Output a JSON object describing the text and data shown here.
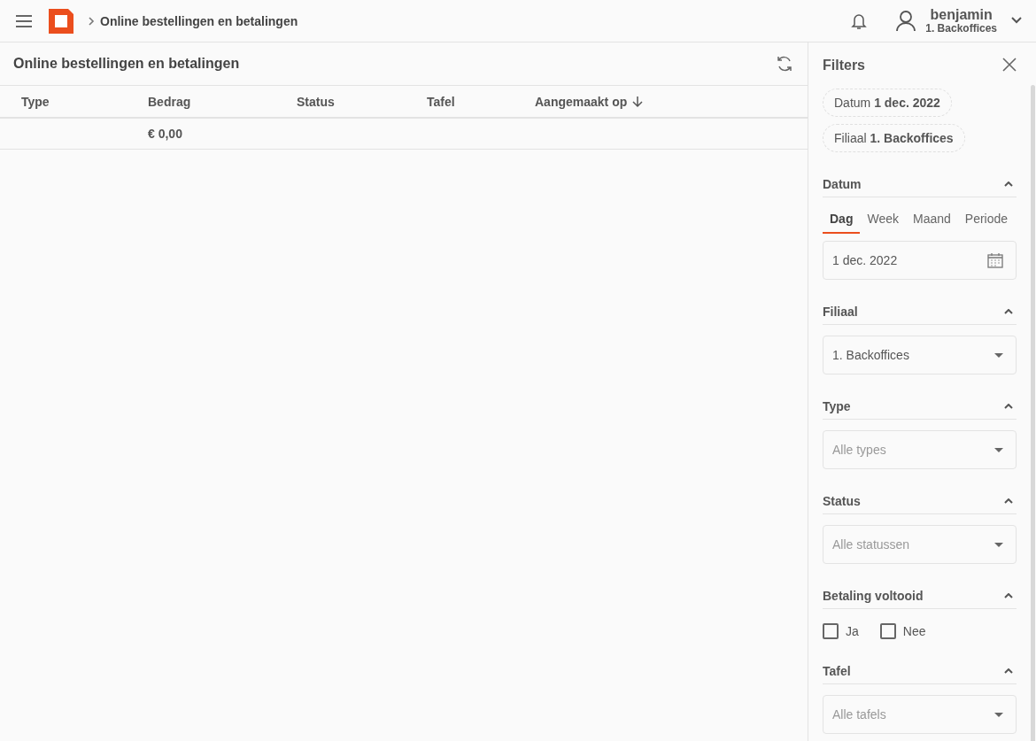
{
  "header": {
    "breadcrumb": "Online bestellingen en betalingen",
    "user": {
      "name": "benjamin",
      "branch": "1. Backoffices"
    }
  },
  "main": {
    "title": "Online bestellingen en betalingen",
    "columns": [
      {
        "label": "Type",
        "sorted": false
      },
      {
        "label": "Bedrag",
        "sorted": false
      },
      {
        "label": "Status",
        "sorted": false
      },
      {
        "label": "Tafel",
        "sorted": false
      },
      {
        "label": "Aangemaakt op",
        "sorted": true
      }
    ],
    "rows": [
      [
        "",
        "€ 0,00",
        "",
        "",
        ""
      ]
    ]
  },
  "filters": {
    "title": "Filters",
    "chips": [
      "Datum **1 dec. 2022**",
      "Filiaal **1. Backoffices**"
    ],
    "sections": [
      {
        "kind": "date",
        "title": "Datum",
        "expanded": true,
        "tabs": [
          {
            "label": "Dag",
            "selected": true
          },
          {
            "label": "Week",
            "selected": false
          },
          {
            "label": "Maand",
            "selected": false
          },
          {
            "label": "Periode",
            "selected": false
          }
        ],
        "value": "1 dec. 2022"
      },
      {
        "kind": "select",
        "title": "Filiaal",
        "expanded": true,
        "value": "1. Backoffices"
      },
      {
        "kind": "select",
        "title": "Type",
        "expanded": true,
        "placeholder": "Alle types"
      },
      {
        "kind": "select",
        "title": "Status",
        "expanded": true,
        "placeholder": "Alle statussen"
      },
      {
        "kind": "checks",
        "title": "Betaling voltooid",
        "expanded": true,
        "options": [
          {
            "label": "Ja",
            "checked": false
          },
          {
            "label": "Nee",
            "checked": false
          }
        ]
      },
      {
        "kind": "select",
        "title": "Tafel",
        "expanded": true,
        "placeholder": "Alle tafels"
      }
    ]
  }
}
